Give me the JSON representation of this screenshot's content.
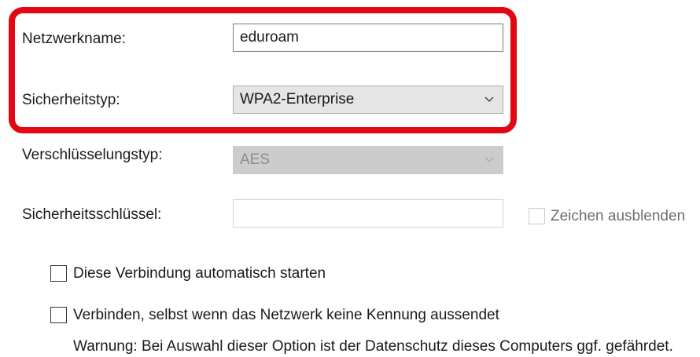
{
  "form": {
    "network_name": {
      "label": "Netzwerkname:",
      "value": "eduroam"
    },
    "security_type": {
      "label": "Sicherheitstyp:",
      "selected": "WPA2-Enterprise"
    },
    "encryption_type": {
      "label": "Verschlüsselungstyp:",
      "selected": "AES"
    },
    "security_key": {
      "label": "Sicherheitsschlüssel:",
      "value": ""
    },
    "hide_characters": {
      "label": "Zeichen ausblenden",
      "checked": false
    }
  },
  "options": {
    "auto_connect": {
      "label": "Diese Verbindung automatisch starten",
      "checked": false
    },
    "connect_hidden": {
      "label": "Verbinden, selbst wenn das Netzwerk keine Kennung aussendet",
      "checked": false
    },
    "warning": "Warnung: Bei Auswahl dieser Option ist der Datenschutz dieses Computers ggf. gefährdet."
  },
  "colors": {
    "highlight": "#e30613"
  },
  "icons": {
    "dropdown": "chevron-down-icon"
  }
}
